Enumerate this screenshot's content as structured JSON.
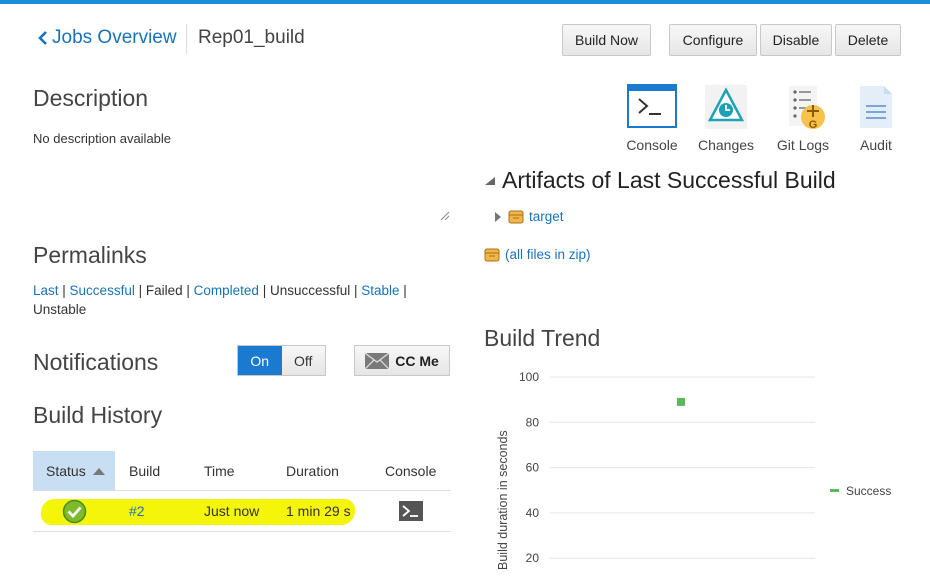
{
  "header": {
    "back_label": "Jobs Overview",
    "job_name": "Rep01_build",
    "buttons": {
      "build_now": "Build Now",
      "configure": "Configure",
      "disable": "Disable",
      "delete": "Delete"
    }
  },
  "description": {
    "title": "Description",
    "text": "No description available"
  },
  "permalinks": {
    "title": "Permalinks",
    "items": [
      {
        "label": "Last",
        "link": true
      },
      {
        "label": "Successful",
        "link": true
      },
      {
        "label": "Failed",
        "link": false
      },
      {
        "label": "Completed",
        "link": true
      },
      {
        "label": "Unsuccessful",
        "link": false
      },
      {
        "label": "Stable",
        "link": true
      },
      {
        "label": "Unstable",
        "link": false
      }
    ]
  },
  "notifications": {
    "title": "Notifications",
    "on_label": "On",
    "off_label": "Off",
    "state": "on",
    "cc_me_label": "CC Me"
  },
  "build_history": {
    "title": "Build History",
    "columns": [
      "Status",
      "Build",
      "Time",
      "Duration",
      "Console"
    ],
    "sorted_column": "Status",
    "rows": [
      {
        "status": "success",
        "build": "#2",
        "time": "Just now",
        "duration": "1 min 29 s"
      }
    ]
  },
  "tools": [
    {
      "name": "console",
      "label": "Console"
    },
    {
      "name": "changes",
      "label": "Changes"
    },
    {
      "name": "git-logs",
      "label": "Git Logs"
    },
    {
      "name": "audit",
      "label": "Audit"
    }
  ],
  "artifacts": {
    "title": "Artifacts of Last Successful Build",
    "folder": "target",
    "zip_label": "(all files in zip)"
  },
  "build_trend": {
    "title": "Build Trend"
  },
  "colors": {
    "accent": "#1a7ad0",
    "link": "#1a72b8",
    "success": "#5cb85c",
    "highlight": "#f5f50a"
  },
  "chart_data": {
    "type": "scatter",
    "title": "Build Trend",
    "ylabel": "Build duration in seconds",
    "xlabel": "",
    "ylim": [
      20,
      100
    ],
    "yticks": [
      100,
      80,
      60,
      40,
      20
    ],
    "series": [
      {
        "name": "Success",
        "color": "#5cb85c",
        "points": [
          {
            "x": 2,
            "y": 89
          }
        ]
      }
    ],
    "legend": "right"
  }
}
